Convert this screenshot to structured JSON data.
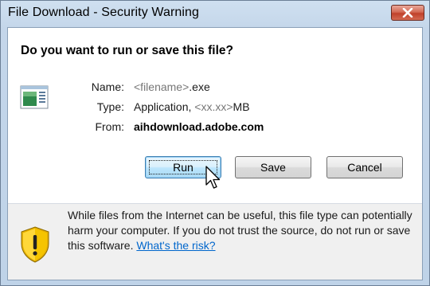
{
  "window": {
    "title": "File Download - Security Warning"
  },
  "dialog": {
    "question": "Do you want to run or save this file?",
    "name_label": "Name:",
    "name_placeholder": "<filename>",
    "name_ext": ".exe",
    "type_label": "Type:",
    "type_value": "Application,",
    "type_size_placeholder": "<xx.xx>",
    "type_unit": "MB",
    "from_label": "From:",
    "from_value": "aihdownload.adobe.com"
  },
  "buttons": {
    "run": "Run",
    "save": "Save",
    "cancel": "Cancel"
  },
  "footer": {
    "warning_text": "While files from the Internet can be useful, this file type can potentially harm your computer. If you do not trust the source, do not run or save this software.",
    "risk_link": "What's the risk?"
  },
  "icons": {
    "close": "close-icon",
    "file": "application-file-icon",
    "shield": "security-shield-icon",
    "cursor": "mouse-pointer-icon"
  },
  "colors": {
    "close_red": "#c0402a",
    "link": "#0066cc",
    "default_button": "#bee6fd",
    "footer_bg": "#f0f0f0",
    "shield_yellow": "#f5c400"
  }
}
